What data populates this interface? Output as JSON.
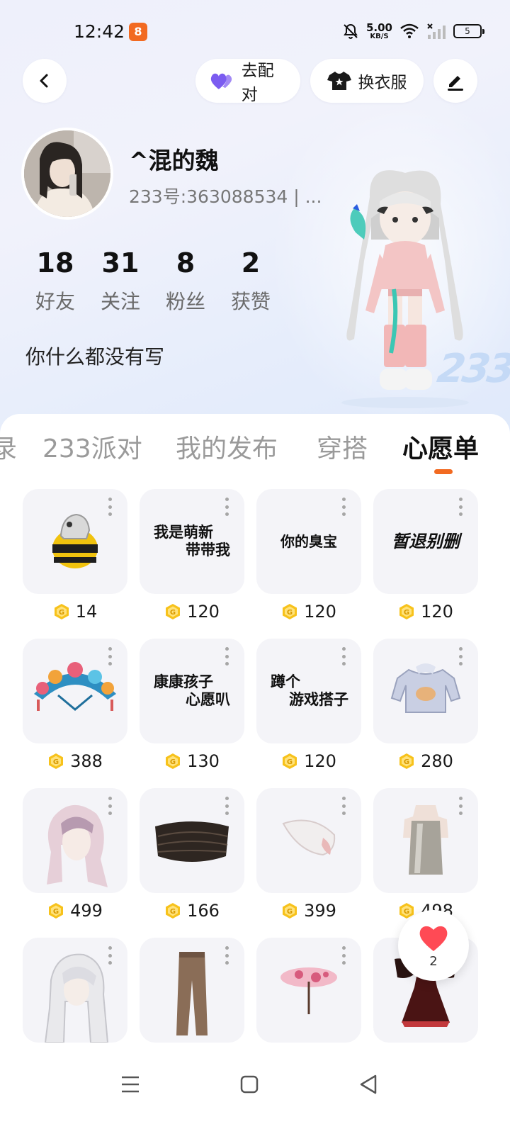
{
  "status_bar": {
    "time": "12:42",
    "app_icon": "orange-app-icon",
    "net_speed_value": "5.00",
    "net_speed_unit": "KB/S",
    "battery": "5"
  },
  "header": {
    "pair_label": "去配对",
    "dress_label": "换衣服"
  },
  "profile": {
    "name": "^混的魏",
    "id": "233号:363088534 | ...",
    "bio": "你什么都没有写",
    "badge": "233",
    "stats": [
      {
        "value": "18",
        "label": "好友"
      },
      {
        "value": "31",
        "label": "关注"
      },
      {
        "value": "8",
        "label": "粉丝"
      },
      {
        "value": "2",
        "label": "获赞"
      }
    ]
  },
  "tabs": [
    {
      "label": "录"
    },
    {
      "label": "233派对"
    },
    {
      "label": "我的发布"
    },
    {
      "label": "穿搭"
    },
    {
      "label": "心愿单"
    }
  ],
  "active_tab": "心愿单",
  "wishlist": [
    {
      "price": "14",
      "art": "bee-helmet"
    },
    {
      "price": "120",
      "line1": "我是萌新",
      "line2": "带带我"
    },
    {
      "price": "120",
      "line1": "你的臭宝"
    },
    {
      "price": "120",
      "line1": "暂退别删"
    },
    {
      "price": "388",
      "art": "flower-crown"
    },
    {
      "price": "130",
      "line1": "康康孩子",
      "line2": "心愿叭"
    },
    {
      "price": "120",
      "line1": "蹲个",
      "line2": "游戏搭子"
    },
    {
      "price": "280",
      "art": "sweater"
    },
    {
      "price": "499",
      "art": "pink-hair"
    },
    {
      "price": "166",
      "art": "dark-belt"
    },
    {
      "price": "399",
      "art": "feather"
    },
    {
      "price": "498",
      "art": "silver-dress"
    },
    {
      "art": "white-hair"
    },
    {
      "art": "brown-pants"
    },
    {
      "art": "pink-umbrella"
    },
    {
      "art": "butterfly-dress"
    }
  ],
  "floating_like": {
    "count": "2"
  },
  "colors": {
    "accent": "#f26a21",
    "coin": "#f7c21b",
    "heart": "#ff4a55",
    "pair_heart": "#7b5cf0"
  }
}
